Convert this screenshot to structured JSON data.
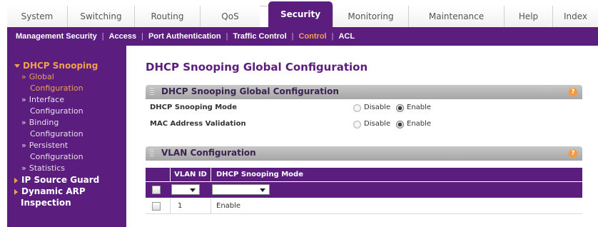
{
  "tabs": [
    {
      "label": "System",
      "active": false
    },
    {
      "label": "Switching",
      "active": false
    },
    {
      "label": "Routing",
      "active": false
    },
    {
      "label": "QoS",
      "active": false
    },
    {
      "label": "Security",
      "active": true
    },
    {
      "label": "Monitoring",
      "active": false
    },
    {
      "label": "Maintenance",
      "active": false
    },
    {
      "label": "Help",
      "active": false
    },
    {
      "label": "Index",
      "active": false
    }
  ],
  "subnav": [
    {
      "label": "Management Security",
      "active": false
    },
    {
      "label": "Access",
      "active": false
    },
    {
      "label": "Port Authentication",
      "active": false
    },
    {
      "label": "Traffic Control",
      "active": false
    },
    {
      "label": "Control",
      "active": true
    },
    {
      "label": "ACL",
      "active": false
    }
  ],
  "sidebar": {
    "dhcp_snooping": "DHCP Snooping",
    "global": "Global",
    "global_cont": "Configuration",
    "interface": "Interface",
    "interface_cont": "Configuration",
    "binding": "Binding",
    "binding_cont": "Configuration",
    "persistent": "Persistent",
    "persistent_cont": "Configuration",
    "statistics": "Statistics",
    "ip_source_guard": "IP Source Guard",
    "dynamic_arp": "Dynamic ARP",
    "dynamic_arp_cont": "Inspection",
    "bullet": "»"
  },
  "main": {
    "page_title": "DHCP Snooping Global Configuration",
    "global_panel": {
      "title": "DHCP Snooping Global Configuration",
      "rows": [
        {
          "label": "DHCP Snooping Mode",
          "disable": "Disable",
          "enable": "Enable",
          "selected": "Enable"
        },
        {
          "label": "MAC Address Validation",
          "disable": "Disable",
          "enable": "Enable",
          "selected": "Enable"
        }
      ]
    },
    "vlan_panel": {
      "title": "VLAN Configuration",
      "columns": [
        "VLAN ID",
        "DHCP Snooping Mode"
      ],
      "filter": {
        "vlan_id": "",
        "mode": ""
      },
      "rows": [
        {
          "vlan_id": "1",
          "mode": "Enable"
        }
      ]
    },
    "help_glyph": "?"
  },
  "colors": {
    "brand_purple": "#5b1e7e",
    "accent_orange": "#f0a24a",
    "panel_header_gray": "#b5b5b5"
  }
}
